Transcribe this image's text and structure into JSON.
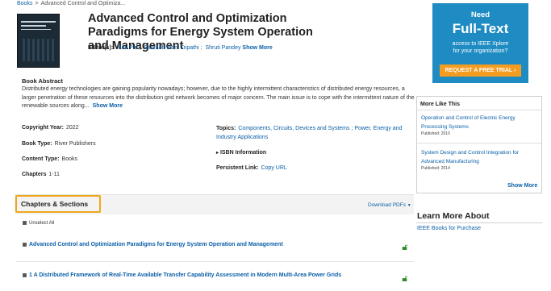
{
  "breadcrumb": {
    "root": "Books",
    "separator": ">",
    "current": "Advanced Control and Optimiza..."
  },
  "book": {
    "title": "Advanced Control and Optimization Paradigms for Energy System Operation and Management",
    "editors_label": "Editor(s):",
    "editors": [
      "Kirti Pal",
      "Saurabh Mani Tripathi",
      "Shruti Pandey"
    ],
    "editors_more": "Show More"
  },
  "abstract": {
    "heading": "Book Abstract",
    "text": "Distributed energy technologies are gaining popularity nowadays; however, due to the highly intermittent characteristics of distributed energy resources, a larger penetration of these resources into the distribution grid network becomes of major concern. The main issue is to cope with the intermittent nature of the renewable sources along...",
    "more": "Show More"
  },
  "meta": {
    "copyright_label": "Copyright Year:",
    "copyright_value": "2022",
    "booktype_label": "Book Type:",
    "booktype_value": "River Publishers",
    "contenttype_label": "Content Type:",
    "contenttype_value": "Books",
    "chapters_label": "Chapters",
    "chapters_value": "1-11",
    "topics_label": "Topics:",
    "topics_value": "Components, Circuits, Devices and Systems ; Power, Energy and Industry Applications",
    "isbn_label": "ISBN Information",
    "persistent_label": "Persistent Link:",
    "persistent_value": "Copy URL"
  },
  "chapters": {
    "heading": "Chapters & Sections",
    "download": "Download PDFs",
    "unselect_all": "Unselect All",
    "items": [
      {
        "title": "Advanced Control and Optimization Paradigms for Energy System Operation and Management"
      },
      {
        "title": "1 A Distributed Framework of Real-Time Available Transfer Capability Assessment in Modern Multi-Area Power Grids"
      }
    ]
  },
  "ad": {
    "need": "Need",
    "full_text": "Full-Text",
    "access_line1": "access to IEEE Xplore",
    "access_line2": "for your organization?",
    "cta": "REQUEST A FREE TRIAL",
    "cta_arrow": "›"
  },
  "more_like_this": {
    "heading": "More Like This",
    "items": [
      {
        "title": "Operation and Control of Electric Energy Processing Systems",
        "published": "Published: 2010"
      },
      {
        "title": "System Design and Control Integration for Advanced Manufacturing",
        "published": "Published: 2014"
      }
    ],
    "show_more": "Show More"
  },
  "learn_more": {
    "heading": "Learn More About",
    "link": "IEEE Books for Purchase"
  },
  "colors": {
    "link": "#0a5fa8",
    "highlight": "#f0a71e",
    "ad_bg": "#1e8bc3",
    "cta_bg": "#f39c1f",
    "lock": "#2e8b2e"
  },
  "icons": {
    "checkbox": "checkbox-icon",
    "lock": "unlock-icon",
    "caret": "caret-down-icon"
  }
}
